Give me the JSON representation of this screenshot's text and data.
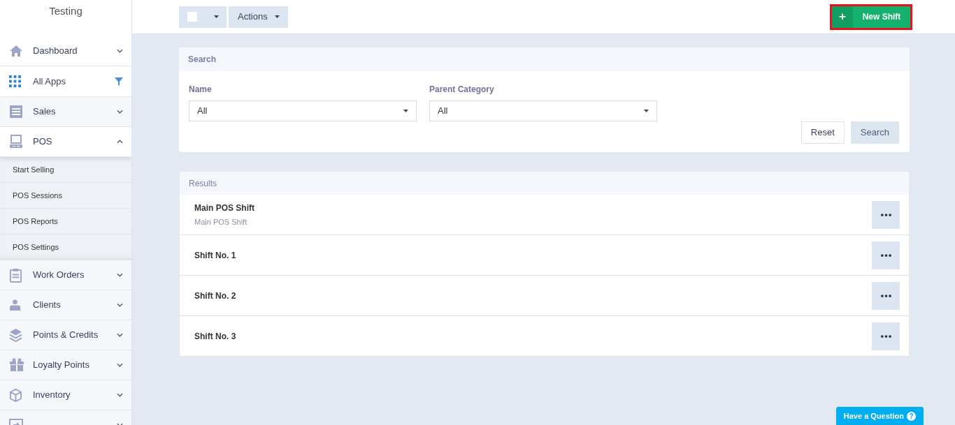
{
  "sidebar": {
    "title": "Testing",
    "items": [
      {
        "label": "Dashboard",
        "kind": "menu",
        "expanded": false
      },
      {
        "label": "All Apps",
        "kind": "filter"
      },
      {
        "label": "Sales",
        "kind": "menu",
        "expanded": false
      },
      {
        "label": "POS",
        "kind": "menu",
        "expanded": true,
        "children": [
          {
            "label": "Start Selling"
          },
          {
            "label": "POS Sessions"
          },
          {
            "label": "POS Reports"
          },
          {
            "label": "POS Settings"
          }
        ]
      },
      {
        "label": "Work Orders",
        "kind": "menu",
        "expanded": false
      },
      {
        "label": "Clients",
        "kind": "menu",
        "expanded": false
      },
      {
        "label": "Points & Credits",
        "kind": "menu",
        "expanded": false
      },
      {
        "label": "Loyalty Points",
        "kind": "menu",
        "expanded": false
      },
      {
        "label": "Inventory",
        "kind": "menu",
        "expanded": false
      },
      {
        "kind": "menu",
        "expanded": false
      }
    ]
  },
  "toolbar": {
    "select_all": {
      "checked": false
    },
    "actions_label": "Actions",
    "new_button": {
      "icon": "+",
      "label": "New Shift",
      "highlighted": true
    }
  },
  "search_panel": {
    "title": "Search",
    "fields": [
      {
        "label": "Name",
        "value": "All"
      },
      {
        "label": "Parent Category",
        "value": "All"
      }
    ],
    "buttons": [
      "Reset",
      "Search"
    ]
  },
  "results": {
    "title": "Results",
    "rows": [
      {
        "title": "Main POS Shift",
        "subtitle": "Main POS Shift"
      },
      {
        "title": "Shift No. 1"
      },
      {
        "title": "Shift No. 2"
      },
      {
        "title": "Shift No. 3"
      }
    ]
  },
  "help_button": {
    "label": "Have a Question",
    "icon": "?"
  }
}
